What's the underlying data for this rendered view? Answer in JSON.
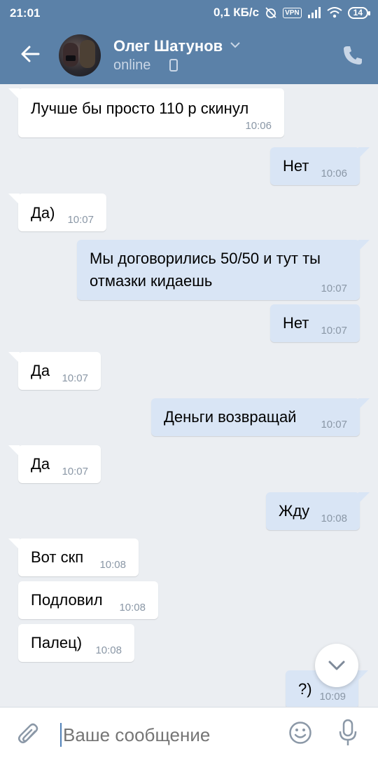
{
  "status_bar": {
    "time": "21:01",
    "speed": "0,1 КБ/с",
    "vpn": "VPN",
    "battery": "14"
  },
  "header": {
    "contact_name": "Олег Шатунов",
    "presence": "online",
    "back_icon": "arrow-left-icon",
    "call_icon": "phone-icon"
  },
  "colors": {
    "header": "#5b81a8",
    "background": "#ebeef2",
    "incoming_bubble": "#ffffff",
    "outgoing_bubble": "#d9e5f5",
    "time_text": "#8a97a6"
  },
  "messages": [
    {
      "direction": "in",
      "lines": [
        "Лучше бы просто 110 р скинул"
      ],
      "time": "10:06"
    },
    {
      "direction": "out",
      "lines": [
        "Нет"
      ],
      "time": "10:06"
    },
    {
      "direction": "in",
      "lines": [
        "Да)"
      ],
      "time": "10:07"
    },
    {
      "direction": "out",
      "lines": [
        "Мы договорились 50/50 и тут ты",
        "отмазки кидаешь"
      ],
      "time": "10:07"
    },
    {
      "direction": "out",
      "lines": [
        "Нет"
      ],
      "time": "10:07"
    },
    {
      "direction": "in",
      "lines": [
        "Да"
      ],
      "time": "10:07"
    },
    {
      "direction": "out",
      "lines": [
        "Деньги возвращай"
      ],
      "time": "10:07"
    },
    {
      "direction": "in",
      "lines": [
        "Да"
      ],
      "time": "10:07"
    },
    {
      "direction": "out",
      "lines": [
        "Жду"
      ],
      "time": "10:08"
    },
    {
      "direction": "in",
      "lines": [
        "Вот скп"
      ],
      "time": "10:08"
    },
    {
      "direction": "in",
      "lines": [
        "Подловил"
      ],
      "time": "10:08"
    },
    {
      "direction": "in",
      "lines": [
        "Палец)"
      ],
      "time": "10:08"
    },
    {
      "direction": "out",
      "lines": [
        "?)"
      ],
      "time": "10:09"
    }
  ],
  "composer": {
    "placeholder": "Ваше сообщение",
    "attach_icon": "paperclip-icon",
    "emoji_icon": "smile-icon",
    "voice_icon": "microphone-icon"
  }
}
